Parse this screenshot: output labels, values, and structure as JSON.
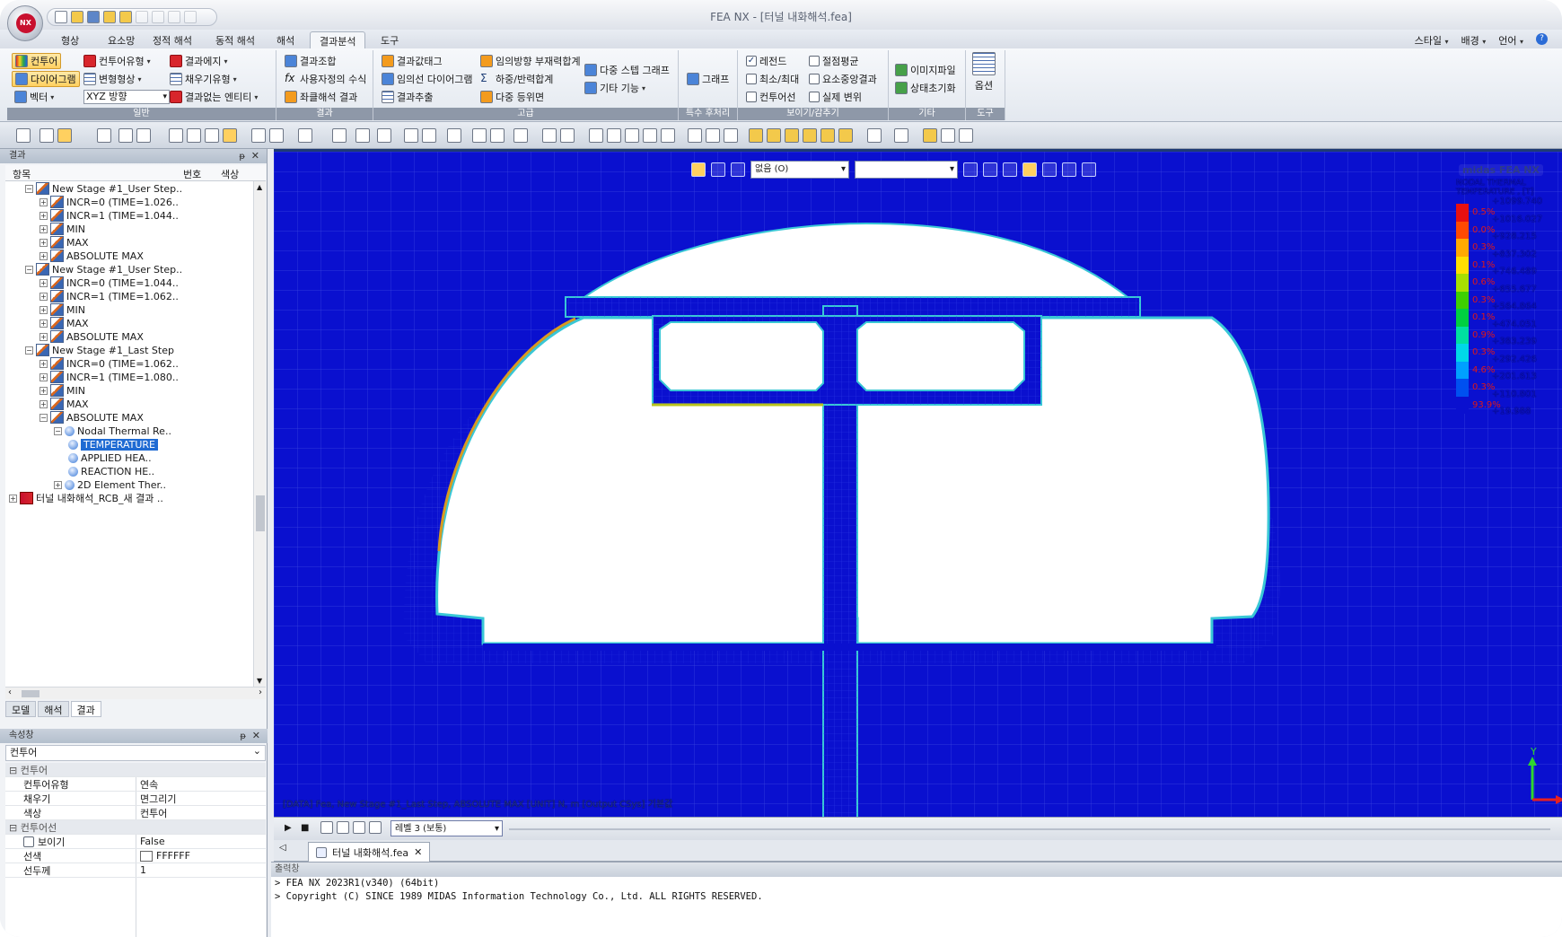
{
  "window": {
    "title": "FEA NX - [터널 내화해석.fea]",
    "logo_text": "NX"
  },
  "menu": {
    "tabs": [
      "형상",
      "요소망",
      "정적 해석",
      "동적 해석",
      "해석",
      "결과분석",
      "도구"
    ],
    "active_tab": "결과분석",
    "right": [
      "스타일",
      "배경",
      "언어"
    ]
  },
  "ribbon": {
    "general": {
      "label": "일반",
      "items": [
        "컨투어",
        "다이어그램",
        "벡터",
        "컨투어유형",
        "변형형상",
        "XYZ 방향",
        "결과에지",
        "채우기유형",
        "결과없는 엔티티"
      ]
    },
    "result": {
      "label": "결과",
      "items": [
        "결과조합",
        "사용자정의 수식",
        "좌클해석 결과"
      ]
    },
    "advanced": {
      "label": "고급",
      "items": [
        "결과값태그",
        "임의선 다이어그램",
        "결과추출",
        "임의방향 부재력합계",
        "하중/반력합계",
        "다중 등위면",
        "다중 스텝 그래프",
        "기타 기능"
      ]
    },
    "special": {
      "label": "특수 후처리",
      "items": [
        "그래프"
      ]
    },
    "view": {
      "label": "보이기/감추기",
      "items": [
        {
          "label": "레전드",
          "checked": true
        },
        {
          "label": "최소/최대",
          "checked": false
        },
        {
          "label": "컨투어선",
          "checked": false
        },
        {
          "label": "절점평균",
          "checked": false
        },
        {
          "label": "요소중앙결과",
          "checked": false
        },
        {
          "label": "실제 변위",
          "checked": false
        }
      ]
    },
    "etc": {
      "label": "기타",
      "items": [
        "이미지파일",
        "상태초기화"
      ]
    },
    "tools": {
      "label": "도구",
      "items": [
        "옵션"
      ]
    }
  },
  "result_panel": {
    "title": "결과",
    "columns": [
      "항목",
      "번호",
      "색상"
    ],
    "tree": [
      {
        "label": "New Stage #1_User Step..",
        "level": 1,
        "icon": "step"
      },
      {
        "label": "INCR=0 (TIME=1.026..",
        "level": 2,
        "icon": "step"
      },
      {
        "label": "INCR=1 (TIME=1.044..",
        "level": 2,
        "icon": "step"
      },
      {
        "label": "MIN",
        "level": 2,
        "icon": "step"
      },
      {
        "label": "MAX",
        "level": 2,
        "icon": "step"
      },
      {
        "label": "ABSOLUTE MAX",
        "level": 2,
        "icon": "step"
      },
      {
        "label": "New Stage #1_User Step..",
        "level": 1,
        "icon": "step"
      },
      {
        "label": "INCR=0 (TIME=1.044..",
        "level": 2,
        "icon": "step"
      },
      {
        "label": "INCR=1 (TIME=1.062..",
        "level": 2,
        "icon": "step"
      },
      {
        "label": "MIN",
        "level": 2,
        "icon": "step"
      },
      {
        "label": "MAX",
        "level": 2,
        "icon": "step"
      },
      {
        "label": "ABSOLUTE MAX",
        "level": 2,
        "icon": "step"
      },
      {
        "label": "New Stage #1_Last Step",
        "level": 1,
        "icon": "step"
      },
      {
        "label": "INCR=0 (TIME=1.062..",
        "level": 2,
        "icon": "step"
      },
      {
        "label": "INCR=1 (TIME=1.080..",
        "level": 2,
        "icon": "step"
      },
      {
        "label": "MIN",
        "level": 2,
        "icon": "step"
      },
      {
        "label": "MAX",
        "level": 2,
        "icon": "step"
      },
      {
        "label": "ABSOLUTE MAX",
        "level": 2,
        "icon": "step"
      },
      {
        "label": "Nodal Thermal Re..",
        "level": 3,
        "icon": "node"
      },
      {
        "label": "TEMPERATURE",
        "level": 4,
        "icon": "node",
        "selected": true
      },
      {
        "label": "APPLIED HEA..",
        "level": 4,
        "icon": "node"
      },
      {
        "label": "REACTION HE..",
        "level": 4,
        "icon": "node"
      },
      {
        "label": "2D Element Ther..",
        "level": 3,
        "icon": "node"
      },
      {
        "label": "터널 내화해석_RCB_새 결과 ..",
        "level": 0,
        "icon": "result"
      }
    ],
    "bottom_tabs": [
      "모델",
      "해석",
      "결과"
    ],
    "active_bottom_tab": "결과"
  },
  "property_panel": {
    "title": "속성창",
    "combo": "컨투어",
    "sections": [
      {
        "name": "컨투어",
        "rows": [
          [
            "컨투어유형",
            "연속"
          ],
          [
            "채우기",
            "면그리기"
          ],
          [
            "색상",
            "컨투어"
          ]
        ]
      },
      {
        "name": "컨투어선",
        "rows": [
          [
            "보이기",
            "False"
          ],
          [
            "선색",
            "FFFFFF"
          ],
          [
            "선두께",
            "1"
          ]
        ]
      }
    ]
  },
  "viewport": {
    "toolbar_select1": "없음 (O)",
    "toolbar_select2": "",
    "brand": "midas FEA NX",
    "legend_title": [
      "NODAL THERMAL",
      "TEMPERATURE , [T]"
    ],
    "legend": [
      {
        "value": "+1099.740",
        "pct": null
      },
      {
        "value": "+1016.027",
        "pct": "0.5%",
        "color": "#e81010"
      },
      {
        "value": "+928.215",
        "pct": "0.0%",
        "color": "#ff4a00"
      },
      {
        "value": "+837.302",
        "pct": "0.3%",
        "color": "#ffaa00"
      },
      {
        "value": "+746.489",
        "pct": "0.1%",
        "color": "#ffe000"
      },
      {
        "value": "+655.677",
        "pct": "0.6%",
        "color": "#a8e000"
      },
      {
        "value": "+564.864",
        "pct": "0.3%",
        "color": "#3ed000"
      },
      {
        "value": "+474.051",
        "pct": "0.1%",
        "color": "#00d040"
      },
      {
        "value": "+383.239",
        "pct": "0.9%",
        "color": "#00e0a0"
      },
      {
        "value": "+292.426",
        "pct": "0.3%",
        "color": "#00d8e8"
      },
      {
        "value": "+201.613",
        "pct": "4.6%",
        "color": "#00a0ff"
      },
      {
        "value": "+110.801",
        "pct": "0.3%",
        "color": "#0050f0"
      },
      {
        "value": "+19.988",
        "pct": "93.9%",
        "color": "#0a10cf"
      }
    ],
    "status": "[DATA] Fea, New Stage #1_Last Step, ABSOLUTE MAX  [UNIT] N, m  [Output CSys] 기본값",
    "axis_label": "Y"
  },
  "animbar": {
    "level_select": "레벨 3 (보통)"
  },
  "doc_tab": {
    "label": "터널 내화해석.fea"
  },
  "output": {
    "title": "출력창",
    "lines": [
      "> FEA NX 2023R1(v340) (64bit)",
      "> Copyright (C) SINCE 1989 MIDAS Information Technology Co., Ltd. ALL RIGHTS RESERVED."
    ]
  },
  "colors": {
    "contour_background": "#0a10cf",
    "selection": "#1f6bd3",
    "active_ribbon": "#ffd060"
  }
}
